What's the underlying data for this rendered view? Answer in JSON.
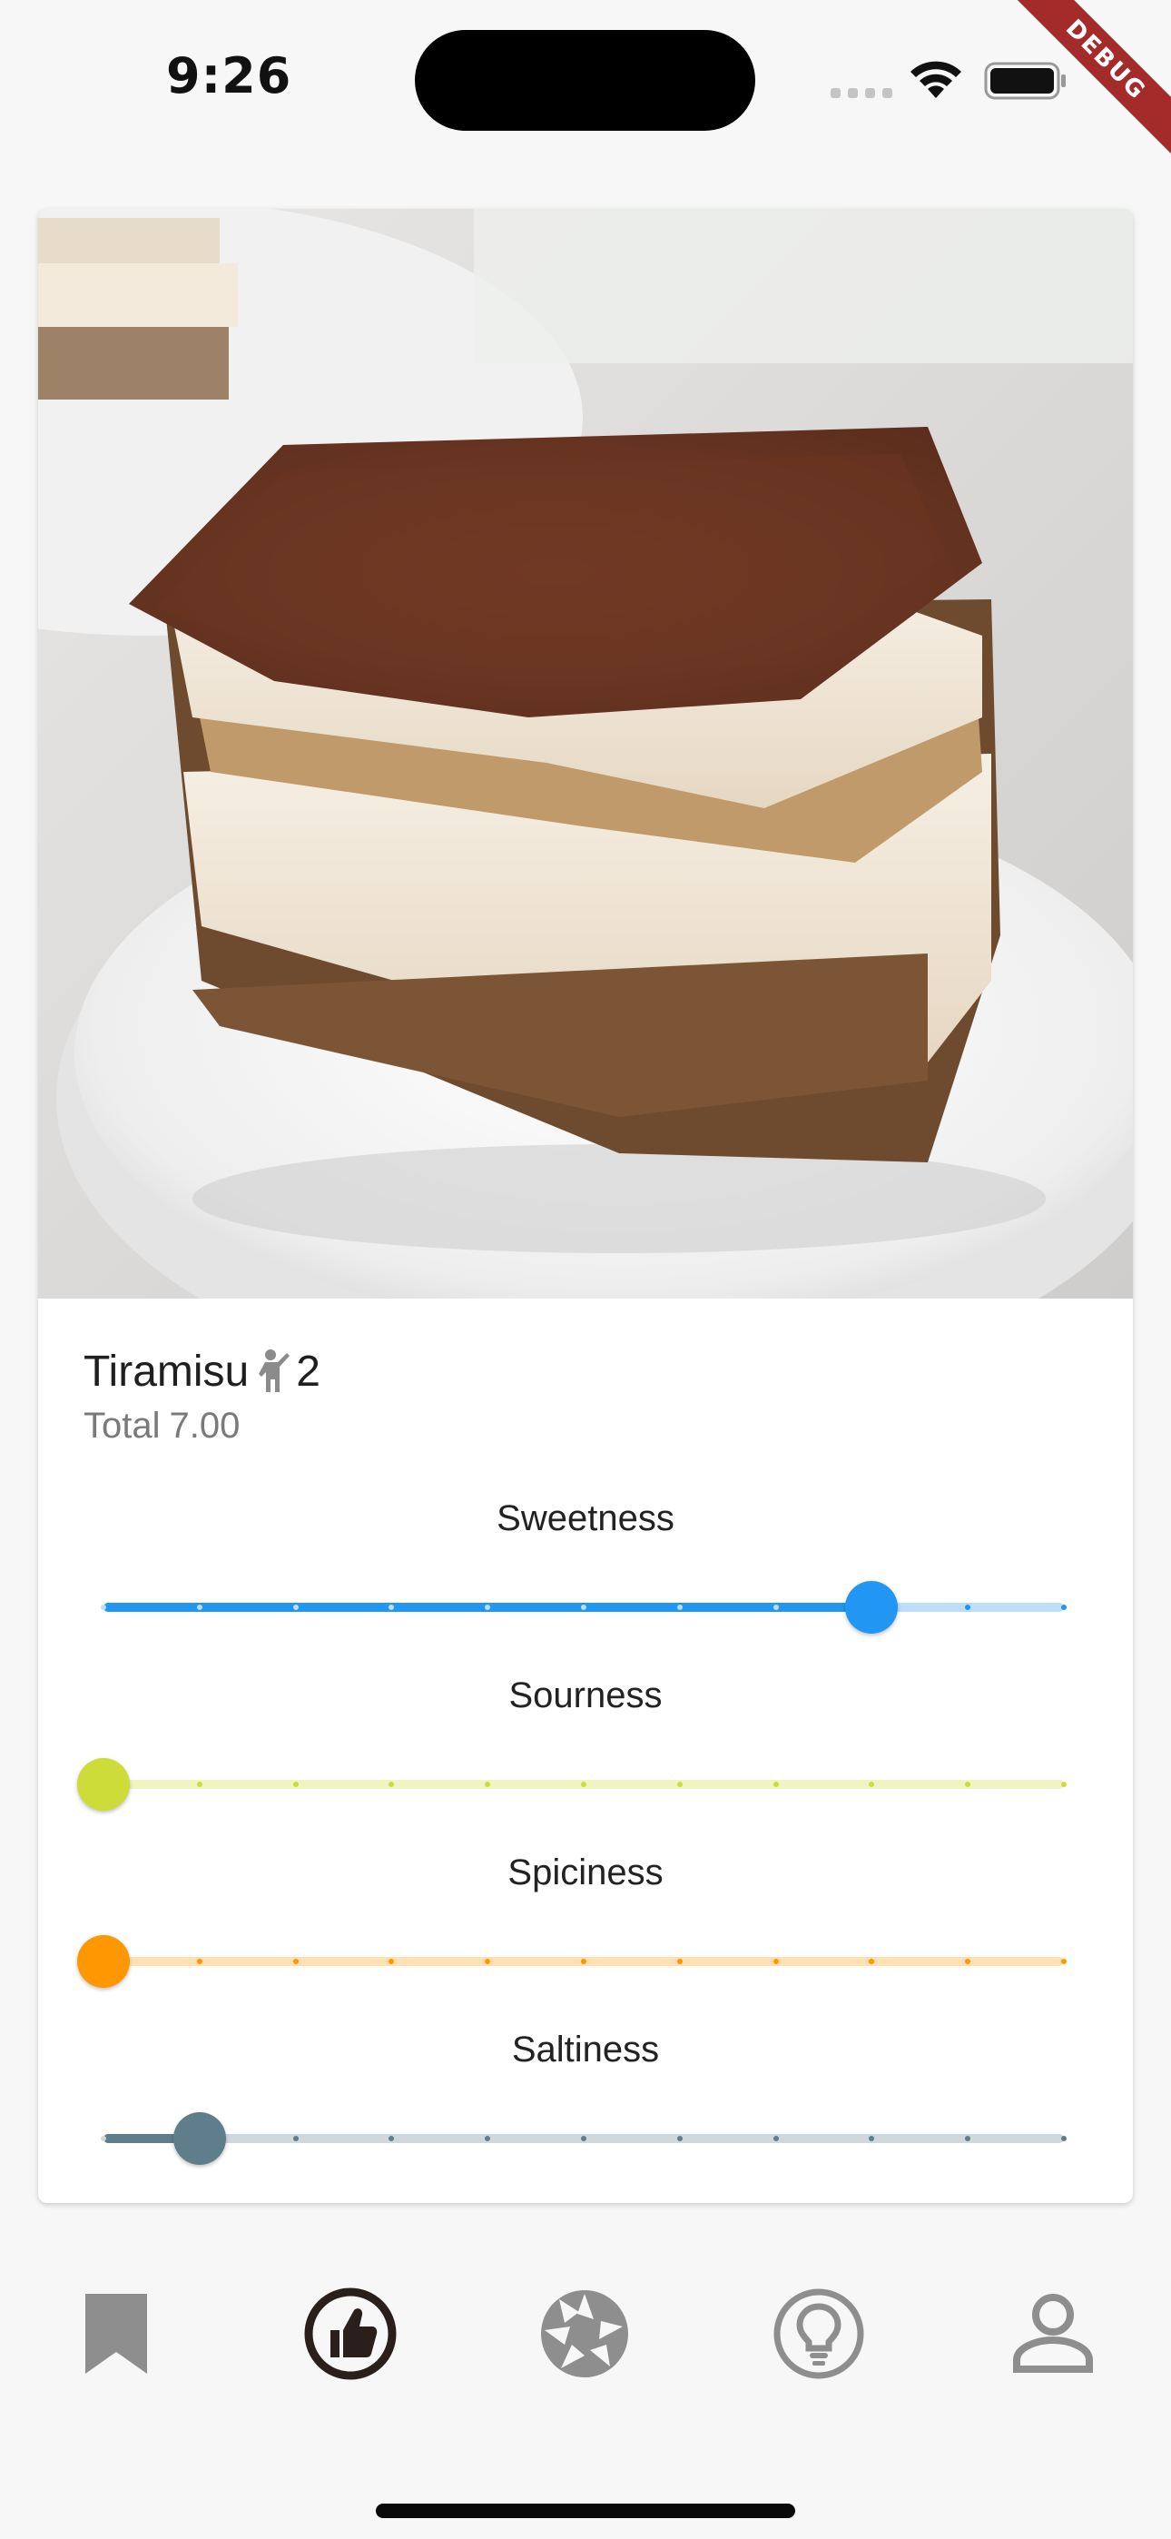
{
  "status_bar": {
    "time": "9:26",
    "debug_label": "DEBUG"
  },
  "dish": {
    "name": "Tiramisu",
    "servings": "2",
    "total_label": "Total",
    "total_value": "7.00"
  },
  "sliders": [
    {
      "label": "Sweetness",
      "value": 8,
      "max": 10,
      "color": "#2196f3",
      "inactive": "#bbdefb"
    },
    {
      "label": "Sourness",
      "value": 0,
      "max": 10,
      "color": "#cddc39",
      "inactive": "#f0f4c3"
    },
    {
      "label": "Spiciness",
      "value": 0,
      "max": 10,
      "color": "#ff9800",
      "inactive": "#ffe0b2"
    },
    {
      "label": "Saltiness",
      "value": 1,
      "max": 10,
      "color": "#607d8b",
      "inactive": "#cfd8dc"
    }
  ],
  "nav": {
    "items": [
      {
        "icon": "bookmark-icon",
        "active": false
      },
      {
        "icon": "thumb-up-icon",
        "active": true
      },
      {
        "icon": "camera-shutter-icon",
        "active": false
      },
      {
        "icon": "lightbulb-icon",
        "active": false
      },
      {
        "icon": "person-icon",
        "active": false
      }
    ],
    "active_color": "#2a1f1b",
    "inactive_color": "#8e8e8e"
  }
}
